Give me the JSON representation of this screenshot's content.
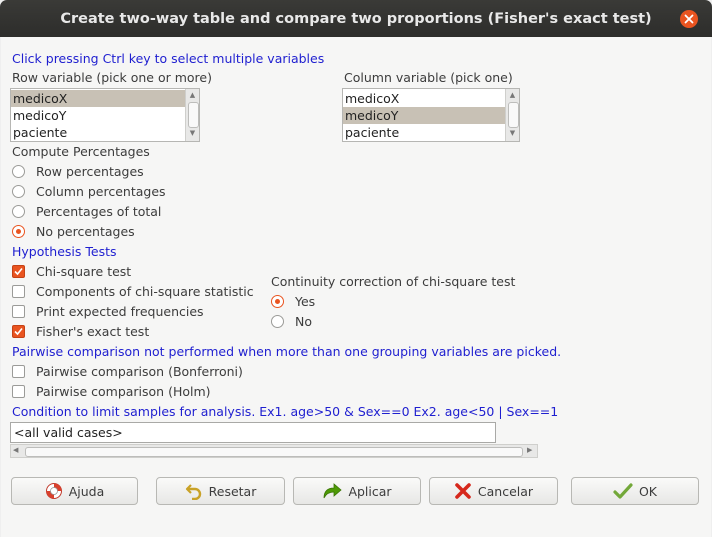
{
  "window": {
    "title": "Create two-way table and compare two proportions (Fisher's exact test)"
  },
  "instructions": "Click pressing Ctrl key to select multiple variables",
  "row_variable": {
    "label": "Row variable (pick one or more)",
    "items": [
      "medicoX",
      "medicoY",
      "paciente"
    ],
    "selected": "medicoX"
  },
  "column_variable": {
    "label": "Column variable (pick one)",
    "items": [
      "medicoX",
      "medicoY",
      "paciente"
    ],
    "selected": "medicoY"
  },
  "percentages": {
    "heading": "Compute Percentages",
    "options": [
      "Row percentages",
      "Column percentages",
      "Percentages of total",
      "No percentages"
    ],
    "selected": "No percentages"
  },
  "hypothesis_tests": {
    "heading": "Hypothesis Tests",
    "options": [
      {
        "label": "Chi-square test",
        "checked": true
      },
      {
        "label": "Components of chi-square statistic",
        "checked": false
      },
      {
        "label": "Print expected frequencies",
        "checked": false
      },
      {
        "label": "Fisher's exact test",
        "checked": true
      }
    ]
  },
  "continuity": {
    "heading": "Continuity correction of chi-square test",
    "options": [
      "Yes",
      "No"
    ],
    "selected": "Yes"
  },
  "pairwise": {
    "heading": "Pairwise comparison not performed when more than one grouping variables are picked.",
    "options": [
      {
        "label": "Pairwise comparison (Bonferroni)",
        "checked": false
      },
      {
        "label": "Pairwise comparison (Holm)",
        "checked": false
      }
    ]
  },
  "condition": {
    "heading": "Condition to limit samples for analysis. Ex1. age>50 & Sex==0  Ex2. age<50 | Sex==1",
    "value": "<all valid cases>"
  },
  "buttons": {
    "help": "Ajuda",
    "reset": "Resetar",
    "apply": "Aplicar",
    "cancel": "Cancelar",
    "ok": "OK"
  },
  "colors": {
    "accent": "#e95420",
    "heading_blue": "#1f1fd0",
    "titlebar": "#2d2d2b"
  }
}
